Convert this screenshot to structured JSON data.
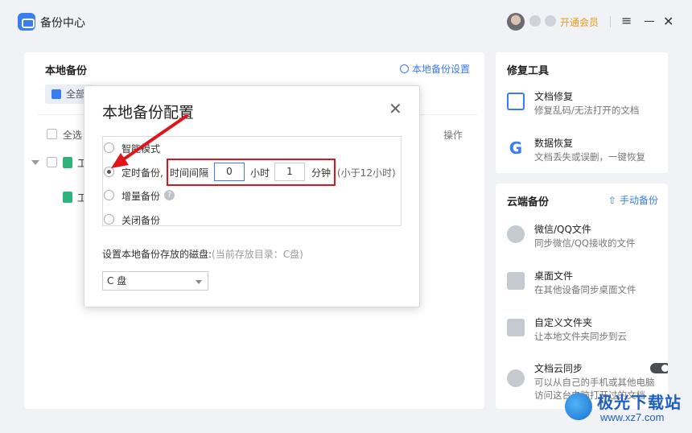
{
  "app": {
    "title": "备份中心"
  },
  "titlebar": {
    "vip_label": "开通会员"
  },
  "colors": {
    "accent": "#3a7cf2",
    "vip": "#e89a19",
    "highlight": "#e0151b",
    "file_icon": "#2fb37b"
  },
  "local_backup": {
    "title": "本地备份",
    "settings_link": "本地备份设置",
    "filter_button": "全部",
    "select_all": "全选",
    "ops_header": "操作",
    "rows": [
      {
        "label": "工"
      },
      {
        "label": "工"
      }
    ]
  },
  "repair_tools": {
    "title": "修复工具",
    "items": [
      {
        "icon": "doc-repair-icon",
        "name": "文档修复",
        "desc": "修复乱码/无法打开的文档"
      },
      {
        "icon": "g-recovery-icon",
        "name": "数据恢复",
        "desc": "文档丢失或误删，一键恢复"
      }
    ]
  },
  "cloud_backup": {
    "title": "云端备份",
    "manual_link": "手动备份",
    "items": [
      {
        "icon": "wechat-qq-icon",
        "name": "微信/QQ文件",
        "desc": "同步微信/QQ接收的文件"
      },
      {
        "icon": "desktop-icon",
        "name": "桌面文件",
        "desc": "在其他设备同步桌面文件"
      },
      {
        "icon": "folder-icon",
        "name": "自定义文件夹",
        "desc": "让本地文件夹同步到云"
      },
      {
        "icon": "cloud-upload-icon",
        "name": "文档云同步",
        "desc": "可以从自己的手机或其他电脑",
        "desc2": "访问这台电脑打开过的文档",
        "toggle_on": true
      }
    ]
  },
  "dialog": {
    "title": "本地备份配置",
    "modes": [
      {
        "label": "智能模式",
        "checked": false
      },
      {
        "label": "定时备份,",
        "checked": true
      },
      {
        "label": "增量备份",
        "checked": false
      },
      {
        "label": "关闭备份",
        "checked": false
      }
    ],
    "interval_label": "时间间隔",
    "hours_value": "0",
    "hours_unit": "小时",
    "minutes_value": "1",
    "minutes_unit": "分钟",
    "limit_hint": "(小于12小时)",
    "disk_label": "设置本地备份存放的磁盘:",
    "disk_hint": "(当前存放目录：C盘)",
    "disk_selected": "C 盘"
  },
  "watermark": {
    "name": "极光下载站",
    "url": "www.xz7.com"
  }
}
